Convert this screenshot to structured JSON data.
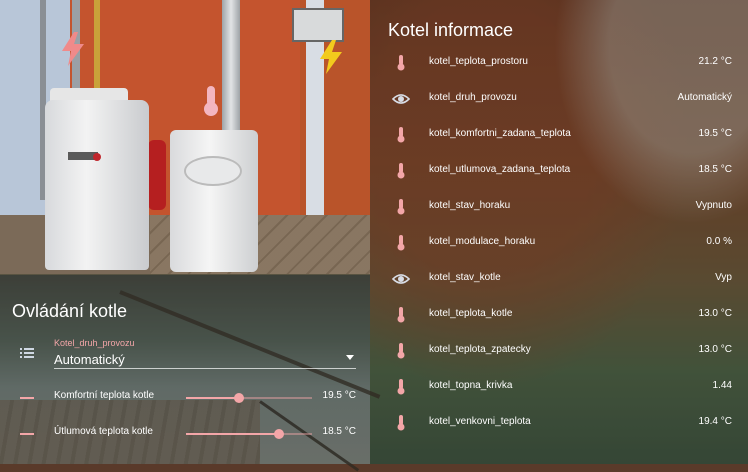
{
  "colors": {
    "accent": "#f3a6a8",
    "text": "#ffffff"
  },
  "photo_card": {
    "icons": [
      "flash-icon",
      "thermometer-icon",
      "flash-icon"
    ],
    "icon_colors": {
      "flash_left": "#f08a8a",
      "thermometer": "#f3b6c0",
      "flash_right": "#f2cb1d"
    }
  },
  "control_card": {
    "title": "Ovládání kotle",
    "select": {
      "label": "Kotel_druh_provozu",
      "value": "Automatický",
      "icon": "list-icon"
    },
    "sliders": [
      {
        "name": "Komfortní teplota kotle",
        "value": "19.5 °C",
        "level": 0.42,
        "icon": "slider-icon"
      },
      {
        "name": "Útlumová teplota kotle",
        "value": "18.5 °C",
        "level": 0.74,
        "icon": "slider-icon"
      }
    ]
  },
  "info_card": {
    "title": "Kotel informace",
    "rows": [
      {
        "icon": "thermometer-icon",
        "name": "kotel_teplota_prostoru",
        "value": "21.2 °C"
      },
      {
        "icon": "eye-icon",
        "name": "kotel_druh_provozu",
        "value": "Automatický"
      },
      {
        "icon": "thermometer-icon",
        "name": "kotel_komfortni_zadana_teplota",
        "value": "19.5 °C"
      },
      {
        "icon": "thermometer-icon",
        "name": "kotel_utlumova_zadana_teplota",
        "value": "18.5 °C"
      },
      {
        "icon": "thermometer-icon",
        "name": "kotel_stav_horaku",
        "value": "Vypnuto"
      },
      {
        "icon": "thermometer-icon",
        "name": "kotel_modulace_horaku",
        "value": "0.0 %"
      },
      {
        "icon": "eye-icon",
        "name": "kotel_stav_kotle",
        "value": "Vyp"
      },
      {
        "icon": "thermometer-icon",
        "name": "kotel_teplota_kotle",
        "value": "13.0 °C"
      },
      {
        "icon": "thermometer-icon",
        "name": "kotel_teplota_zpatecky",
        "value": "13.0 °C"
      },
      {
        "icon": "thermometer-icon",
        "name": "kotel_topna_krivka",
        "value": "1.44"
      },
      {
        "icon": "thermometer-icon",
        "name": "kotel_venkovni_teplota",
        "value": "19.4 °C"
      }
    ]
  }
}
